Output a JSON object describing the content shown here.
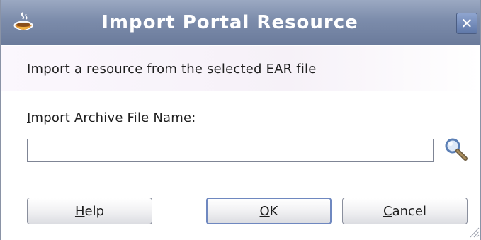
{
  "dialog": {
    "title": "Import Portal Resource",
    "close_glyph": "✕",
    "icons": {
      "app": "oracle-cup-icon",
      "close": "close-icon",
      "search": "magnifier-icon"
    }
  },
  "info": {
    "text": "Import a resource from the selected EAR file"
  },
  "form": {
    "label_mnemonic": "I",
    "label_rest": "mport Archive File Name:",
    "input_value": ""
  },
  "buttons": {
    "help_mnemonic": "H",
    "help_rest": "elp",
    "ok_mnemonic": "O",
    "ok_rest": "K",
    "cancel_mnemonic": "C",
    "cancel_rest": "ancel"
  },
  "colors": {
    "titlebar": "#7c8cab",
    "title_text": "#ffffff",
    "info_bg": "#f6f1f8",
    "default_button_border": "#6f88c0"
  }
}
